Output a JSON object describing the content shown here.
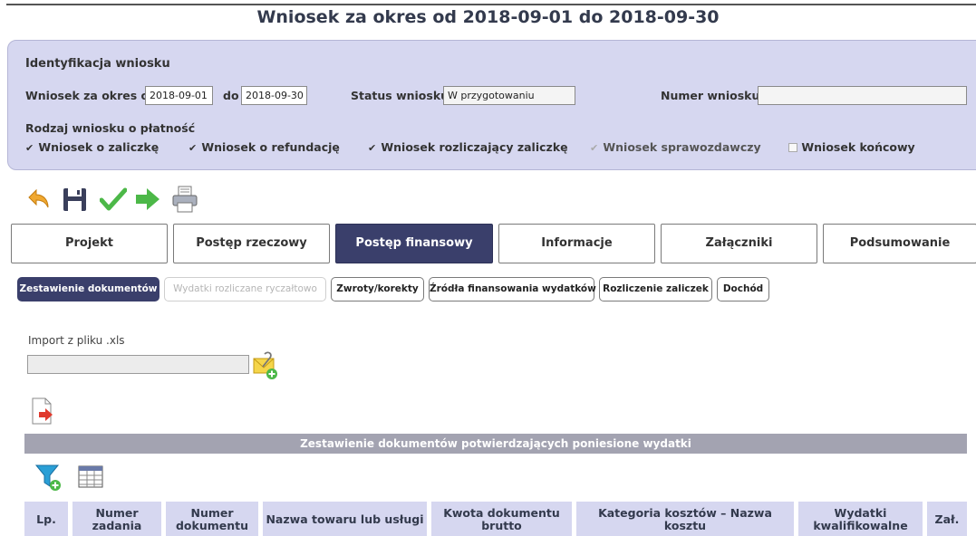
{
  "title": "Wniosek za okres od 2018-09-01 do 2018-09-30",
  "identification": {
    "heading": "Identyfikacja wniosku",
    "period_from_label": "Wniosek za okres od",
    "period_from_value": "2018-09-01",
    "period_to_label": "do",
    "period_to_value": "2018-09-30",
    "status_label": "Status wniosku",
    "status_value": "W przygotowaniu",
    "number_label": "Numer wniosku",
    "number_value": "",
    "type_label": "Rodzaj wniosku o płatność",
    "types": [
      {
        "label": "Wniosek o zaliczkę",
        "checked": true,
        "disabled": false
      },
      {
        "label": "Wniosek o refundację",
        "checked": true,
        "disabled": false
      },
      {
        "label": "Wniosek rozliczający zaliczkę",
        "checked": true,
        "disabled": false
      },
      {
        "label": "Wniosek sprawozdawczy",
        "checked": true,
        "disabled": true
      },
      {
        "label": "Wniosek końcowy",
        "checked": false,
        "disabled": false
      }
    ]
  },
  "toolbar": [
    "back-arrow-icon",
    "save-icon",
    "check-icon",
    "forward-arrow-icon",
    "print-icon"
  ],
  "tabs": [
    "Projekt",
    "Postęp rzeczowy",
    "Postęp finansowy",
    "Informacje",
    "Załączniki",
    "Podsumowanie"
  ],
  "active_tab": "Postęp finansowy",
  "subtabs": [
    "Zestawienie dokumentów",
    "Wydatki rozliczane ryczałtowo",
    "Zwroty/korekty",
    "Źródła finansowania wydatków",
    "Rozliczenie zaliczek",
    "Dochód"
  ],
  "active_subtab": "Zestawienie dokumentów",
  "import": {
    "label": "Import z pliku .xls",
    "value": ""
  },
  "section_title": "Zestawienie dokumentów potwierdzających poniesione wydatki",
  "table_headers": [
    "Lp.",
    "Numer zadania",
    "Numer dokumentu",
    "Nazwa towaru lub usługi",
    "Kwota dokumentu brutto",
    "Kategoria kosztów – Nazwa kosztu",
    "Wydatki kwalifikowalne",
    "Zał."
  ],
  "colors": {
    "header_bg": "#d6d7f0",
    "active_tab": "#3a3f6b",
    "section_bar": "#a3a3b1"
  }
}
